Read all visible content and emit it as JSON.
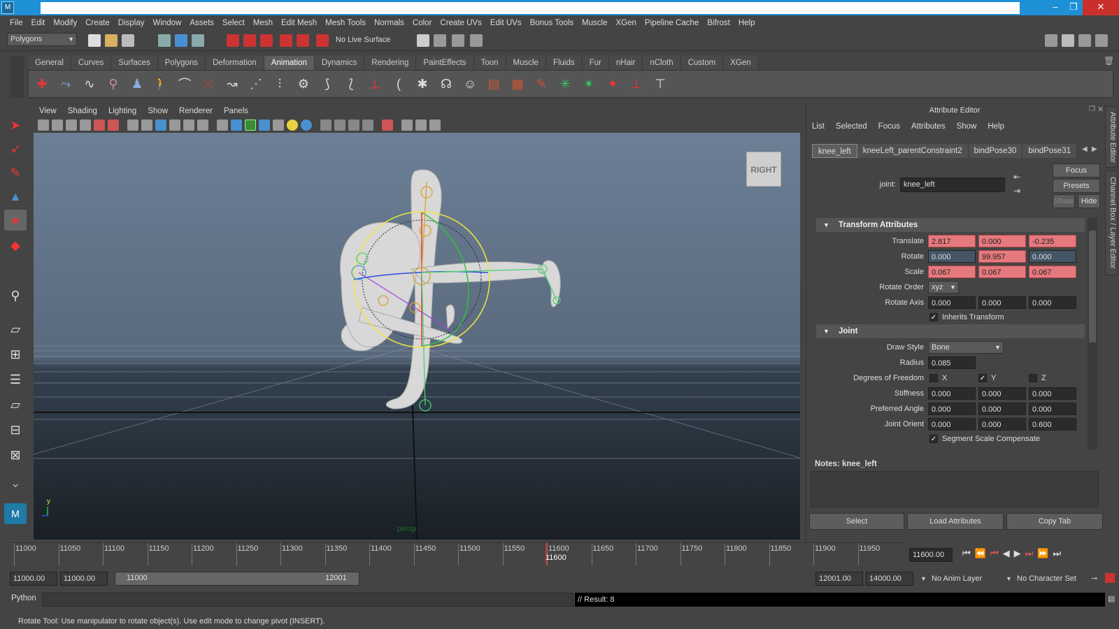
{
  "menubar": [
    "File",
    "Edit",
    "Modify",
    "Create",
    "Display",
    "Window",
    "Assets",
    "Select",
    "Mesh",
    "Edit Mesh",
    "Mesh Tools",
    "Normals",
    "Color",
    "Create UVs",
    "Edit UVs",
    "Bonus Tools",
    "Muscle",
    "XGen",
    "Pipeline Cache",
    "Bifrost",
    "Help"
  ],
  "status": {
    "menuset": "Polygons",
    "live_surface": "No Live Surface"
  },
  "shelf_tabs": [
    {
      "label": "General",
      "active": false
    },
    {
      "label": "Curves",
      "active": false
    },
    {
      "label": "Surfaces",
      "active": false
    },
    {
      "label": "Polygons",
      "active": false
    },
    {
      "label": "Deformation",
      "active": false
    },
    {
      "label": "Animation",
      "active": true
    },
    {
      "label": "Dynamics",
      "active": false
    },
    {
      "label": "Rendering",
      "active": false
    },
    {
      "label": "PaintEffects",
      "active": false
    },
    {
      "label": "Toon",
      "active": false
    },
    {
      "label": "Muscle",
      "active": false
    },
    {
      "label": "Fluids",
      "active": false
    },
    {
      "label": "Fur",
      "active": false
    },
    {
      "label": "nHair",
      "active": false
    },
    {
      "label": "nCloth",
      "active": false
    },
    {
      "label": "Custom",
      "active": false
    },
    {
      "label": "XGen",
      "active": false
    }
  ],
  "viewport": {
    "menu": [
      "View",
      "Shading",
      "Lighting",
      "Show",
      "Renderer",
      "Panels"
    ],
    "viewcube_label": "RIGHT",
    "camera_label": "persp",
    "axis_y": "y"
  },
  "attribute_editor": {
    "title": "Attribute Editor",
    "menu": [
      "List",
      "Selected",
      "Focus",
      "Attributes",
      "Show",
      "Help"
    ],
    "tabs": [
      {
        "label": "knee_left",
        "active": true
      },
      {
        "label": "kneeLeft_parentConstraint2",
        "active": false
      },
      {
        "label": "bindPose30",
        "active": false
      },
      {
        "label": "bindPose31",
        "active": false
      }
    ],
    "node_type_label": "joint:",
    "node_name": "knee_left",
    "buttons": {
      "focus": "Focus",
      "presets": "Presets",
      "show": "Show",
      "hide": "Hide"
    },
    "transform_section": "Transform Attributes",
    "translate": {
      "label": "Translate",
      "values": [
        "2.817",
        "0.000",
        "-0.235"
      ]
    },
    "rotate": {
      "label": "Rotate",
      "values": [
        "0.000",
        "99.957",
        "0.000"
      ]
    },
    "scale": {
      "label": "Scale",
      "values": [
        "0.067",
        "0.067",
        "0.067"
      ]
    },
    "rotate_order": {
      "label": "Rotate Order",
      "value": "xyz"
    },
    "rotate_axis": {
      "label": "Rotate Axis",
      "values": [
        "0.000",
        "0.000",
        "0.000"
      ]
    },
    "inherits_transform": "Inherits Transform",
    "joint_section": "Joint",
    "draw_style": {
      "label": "Draw Style",
      "value": "Bone"
    },
    "radius": {
      "label": "Radius",
      "value": "0.085"
    },
    "dof": {
      "label": "Degrees of Freedom",
      "x": "X",
      "y": "Y",
      "z": "Z"
    },
    "stiffness": {
      "label": "Stiffness",
      "values": [
        "0.000",
        "0.000",
        "0.000"
      ]
    },
    "preferred_angle": {
      "label": "Preferred Angle",
      "values": [
        "0.000",
        "0.000",
        "0.000"
      ]
    },
    "joint_orient": {
      "label": "Joint Orient",
      "values": [
        "0.000",
        "0.000",
        "0.600"
      ]
    },
    "segment_scale": "Segment Scale Compensate",
    "notes_label": "Notes:",
    "notes_node": "knee_left",
    "bottom_buttons": {
      "select": "Select",
      "load": "Load Attributes",
      "copy": "Copy Tab"
    }
  },
  "side_tabs": {
    "attr": "Attribute Editor",
    "channel": "Channel Box / Layer Editor"
  },
  "timeline": {
    "ticks": [
      "11000",
      "11050",
      "11100",
      "11150",
      "11200",
      "11250",
      "11300",
      "11350",
      "11400",
      "11450",
      "11500",
      "11550",
      "11600",
      "11650",
      "11700",
      "11750",
      "11800",
      "11850",
      "11900",
      "11950"
    ],
    "current_label": "11600",
    "current_frame": "11600.00"
  },
  "range": {
    "start": "11000.00",
    "anim_start": "11000.00",
    "range_start": "11000",
    "range_end": "12001",
    "anim_end": "12001.00",
    "end": "14000.00",
    "anim_layer": "No Anim Layer",
    "char_set": "No Character Set"
  },
  "cmdline": {
    "lang": "Python",
    "result": "// Result: 8"
  },
  "helpline": "Rotate Tool: Use manipulator to rotate object(s). Use edit mode to change pivot (INSERT).",
  "colors": {
    "titlebar": "#1e90d6",
    "keyed": "#e5797e",
    "panel": "#444444",
    "manip_yellow": "#f0e640"
  }
}
